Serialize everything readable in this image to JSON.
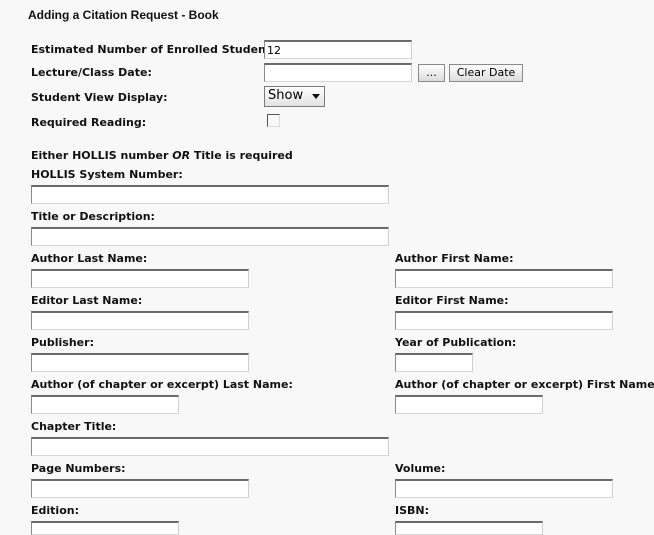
{
  "page": {
    "title": "Adding a Citation Request - Book"
  },
  "course": {
    "enrolled_label": "Estimated Number of Enrolled Students:",
    "enrolled_value": "12",
    "lecture_date_label": "Lecture/Class Date:",
    "lecture_date_value": "",
    "date_picker_label": "...",
    "clear_date_label": "Clear Date",
    "student_view_label": "Student View Display:",
    "student_view_value": "Show",
    "required_reading_label": "Required Reading:",
    "required_reading_checked": false
  },
  "citation": {
    "note_prefix": "Either HOLLIS number ",
    "note_or": "OR",
    "note_suffix": " Title is required",
    "hollis_label": "HOLLIS System Number:",
    "title_label": "Title or Description:",
    "author_last_label": "Author Last Name:",
    "author_first_label": "Author First Name:",
    "editor_last_label": "Editor Last Name:",
    "editor_first_label": "Editor First Name:",
    "publisher_label": "Publisher:",
    "year_label": "Year of Publication:",
    "chapter_author_last_label": "Author (of chapter or excerpt) Last Name:",
    "chapter_author_first_label": "Author (of chapter or excerpt) First Name:",
    "chapter_title_label": "Chapter Title:",
    "page_numbers_label": "Page Numbers:",
    "volume_label": "Volume:",
    "edition_label": "Edition:",
    "isbn_label": "ISBN:"
  }
}
